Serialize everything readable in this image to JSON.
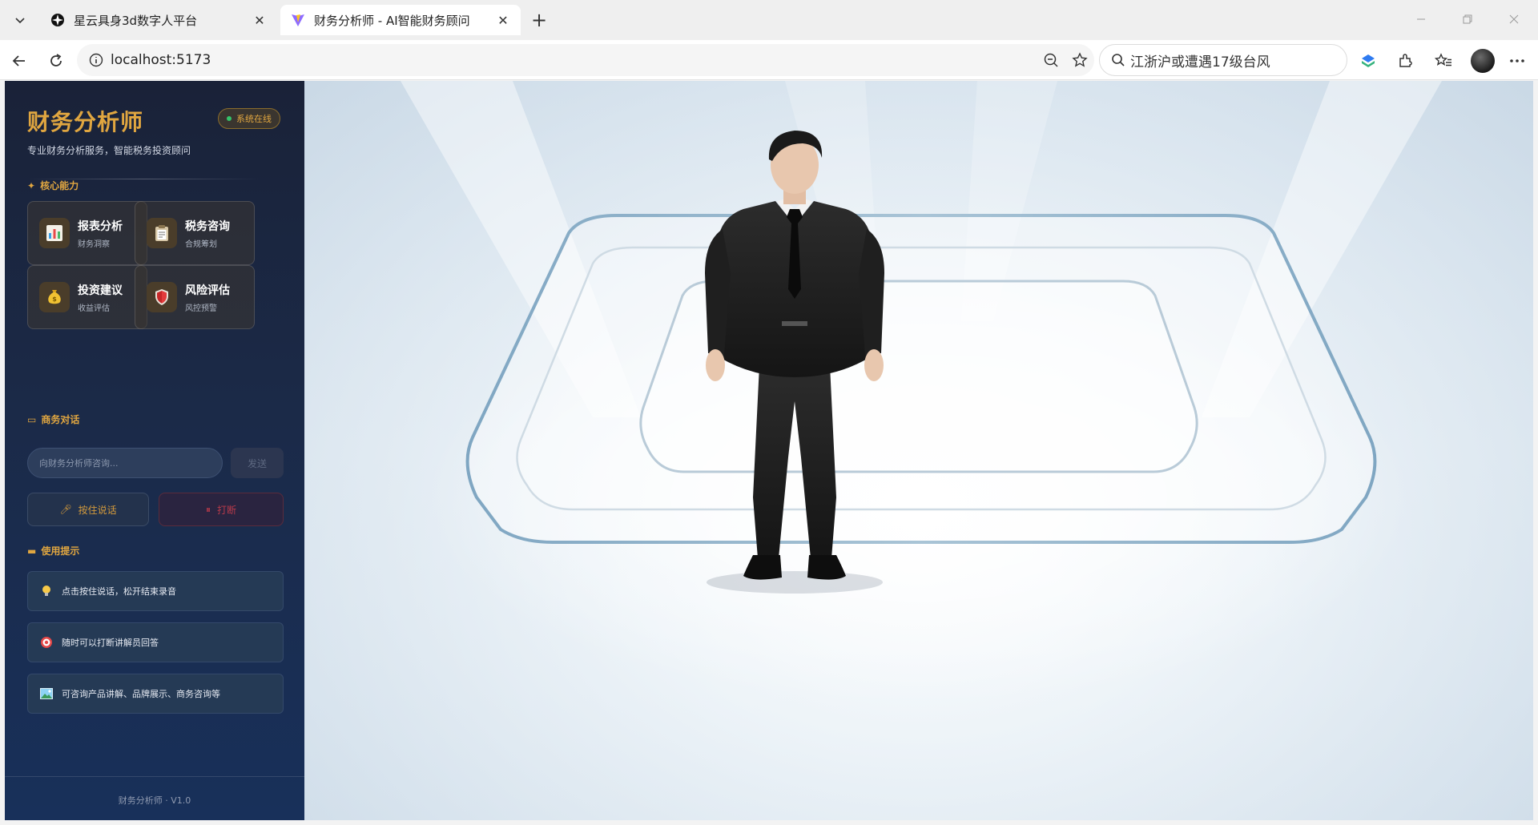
{
  "browser": {
    "tabs": [
      {
        "title": "星云具身3d数字人平台",
        "active": false
      },
      {
        "title": "财务分析师 - AI智能财务顾问",
        "active": true
      }
    ],
    "url": "localhost:5173",
    "search_text": "江浙沪或遭遇17级台风"
  },
  "sidebar": {
    "title": "财务分析师",
    "status": "系统在线",
    "subtitle": "专业财务分析服务，智能税务投资顾问",
    "capabilities_title": "核心能力",
    "capabilities": [
      {
        "name": "报表分析",
        "desc": "财务洞察",
        "icon": "bar-chart-icon"
      },
      {
        "name": "税务咨询",
        "desc": "合规筹划",
        "icon": "clipboard-icon"
      },
      {
        "name": "投资建议",
        "desc": "收益评估",
        "icon": "money-bag-icon"
      },
      {
        "name": "风险评估",
        "desc": "风控预警",
        "icon": "shield-icon"
      }
    ],
    "chat_title": "商务对话",
    "chat_placeholder": "向财务分析师咨询...",
    "send_label": "发送",
    "ptt_label": "按住说话",
    "interrupt_label": "打断",
    "tips_title": "使用提示",
    "tips": [
      {
        "text": "点击按住说话，松开结束录音",
        "icon": "lightbulb-icon"
      },
      {
        "text": "随时可以打断讲解员回答",
        "icon": "target-icon"
      },
      {
        "text": "可咨询产品讲解、品牌展示、商务咨询等",
        "icon": "image-icon"
      }
    ],
    "footer": "财务分析师 · V1.0"
  },
  "colors": {
    "accent": "#e0a640",
    "sidebar_bg": "#1b2a48",
    "online": "#35c46a",
    "danger": "#b83a4a"
  }
}
